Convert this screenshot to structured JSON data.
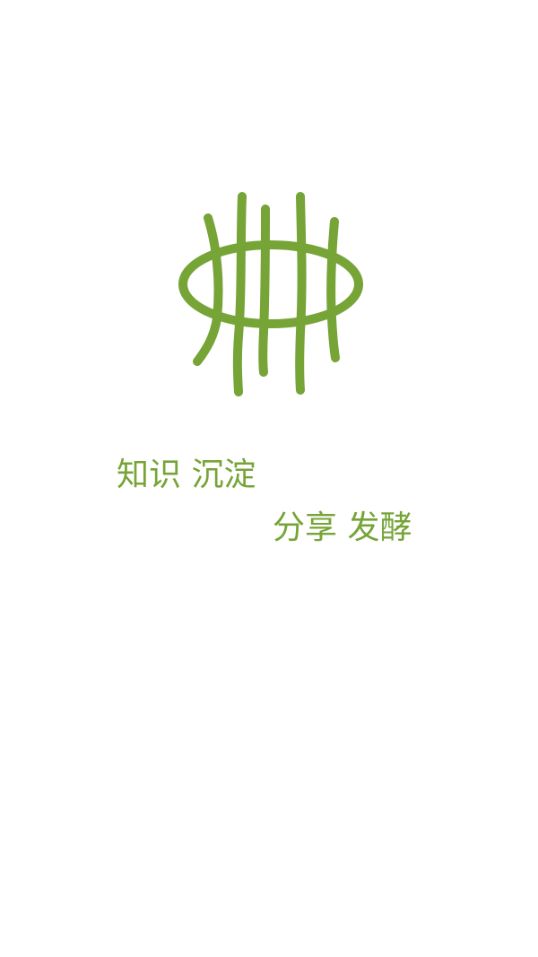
{
  "splash": {
    "tagline_line1": "知识 沉淀",
    "tagline_line2": "分享 发酵",
    "logo_icon": "grass-ring-logo"
  },
  "colors": {
    "brand_green": "#76A437",
    "background": "#FFFFFF"
  }
}
